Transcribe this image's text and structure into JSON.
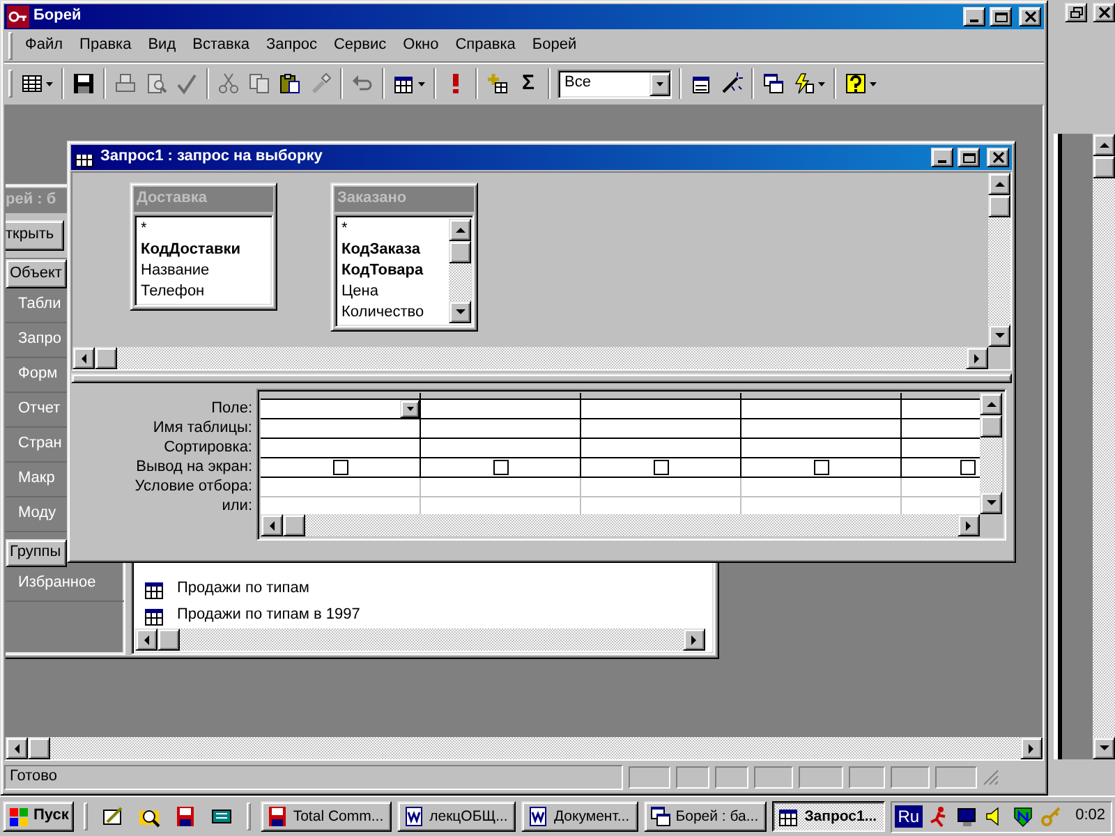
{
  "main_window": {
    "title": "Борей",
    "menu": [
      "Файл",
      "Правка",
      "Вид",
      "Вставка",
      "Запрос",
      "Сервис",
      "Окно",
      "Справка",
      "Борей"
    ],
    "toolbar_groups": [
      [
        {
          "kind": "split",
          "disabled": false
        }
      ],
      [
        {
          "kind": "button",
          "disabled": false
        }
      ],
      [
        {
          "kind": "button",
          "disabled": true
        },
        {
          "kind": "button",
          "disabled": true
        },
        {
          "kind": "button",
          "disabled": true
        }
      ],
      [
        {
          "kind": "button",
          "disabled": true
        },
        {
          "kind": "button",
          "disabled": true
        },
        {
          "kind": "button",
          "disabled": false
        },
        {
          "kind": "button",
          "disabled": true
        }
      ],
      [
        {
          "kind": "button",
          "disabled": true
        }
      ],
      [
        {
          "kind": "split",
          "disabled": false
        }
      ],
      [
        {
          "kind": "button",
          "disabled": false
        }
      ],
      [
        {
          "kind": "button",
          "disabled": false
        },
        {
          "kind": "glyph",
          "text": "Σ",
          "disabled": false
        }
      ],
      [
        {
          "kind": "combo",
          "value": "Все"
        }
      ],
      [
        {
          "kind": "button",
          "disabled": false
        },
        {
          "kind": "button",
          "disabled": false
        }
      ],
      [
        {
          "kind": "button",
          "disabled": false
        },
        {
          "kind": "split",
          "disabled": false
        }
      ],
      [
        {
          "kind": "split",
          "disabled": false
        }
      ]
    ],
    "status_bar": {
      "text": "Готово"
    }
  },
  "database_window": {
    "title": "рей : б",
    "toolbar_button": "ткрыть",
    "objects_header": "Объект",
    "object_types": [
      "Табли",
      "Запро",
      "Форм",
      "Отчет",
      "Стран",
      "Макр",
      "Моду"
    ],
    "groups_header": "Группы",
    "groups": [
      "Избранное"
    ],
    "items": [
      "Продажи по типам",
      "Продажи по типам в 1997"
    ]
  },
  "query_window": {
    "title": "Запрос1 : запрос на выборку",
    "tables": [
      {
        "title": "Доставка",
        "scrollable": false,
        "fields": [
          {
            "name": "*",
            "key": false
          },
          {
            "name": "КодДоставки",
            "key": true
          },
          {
            "name": "Название",
            "key": false
          },
          {
            "name": "Телефон",
            "key": false
          }
        ]
      },
      {
        "title": "Заказано",
        "scrollable": true,
        "fields": [
          {
            "name": "*",
            "key": false
          },
          {
            "name": "КодЗаказа",
            "key": true
          },
          {
            "name": "КодТовара",
            "key": true
          },
          {
            "name": "Цена",
            "key": false
          },
          {
            "name": "Количество",
            "key": false
          }
        ]
      }
    ],
    "grid": {
      "row_labels": [
        "Поле:",
        "Имя таблицы:",
        "Сортировка:",
        "Вывод на экран:",
        "Условие отбора:",
        "или:"
      ],
      "columns": [
        {
          "active": true,
          "show": false
        },
        {
          "active": false,
          "show": false
        },
        {
          "active": false,
          "show": false
        },
        {
          "active": false,
          "show": false
        },
        {
          "active": false,
          "show": false
        }
      ]
    }
  },
  "taskbar": {
    "start": "Пуск",
    "tasks": [
      {
        "label": "Total Comm...",
        "selected": false
      },
      {
        "label": "лекцОБЩ...",
        "selected": false
      },
      {
        "label": "Документ...",
        "selected": false
      },
      {
        "label": "Борей : ба...",
        "selected": false
      },
      {
        "label": "Запрос1...",
        "selected": true
      }
    ],
    "tray": {
      "language": "Ru",
      "clock": "0:02"
    }
  }
}
